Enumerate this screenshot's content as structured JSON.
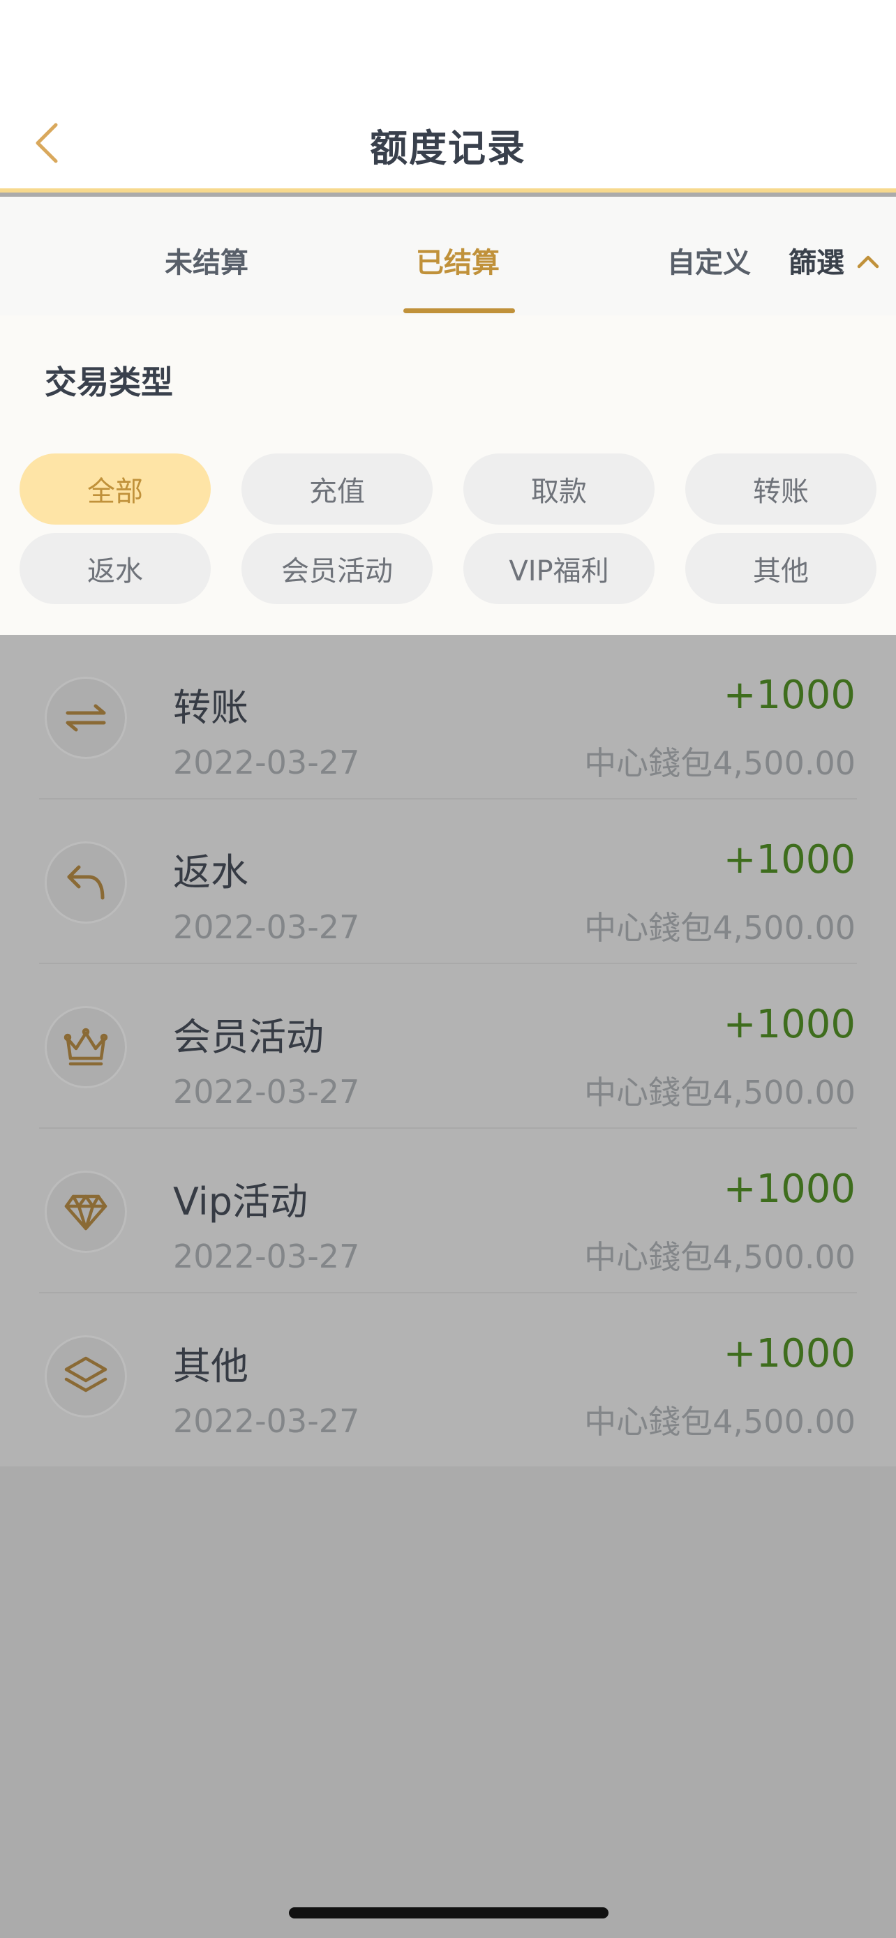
{
  "header": {
    "title": "额度记录"
  },
  "tabs": [
    {
      "label": "未结算"
    },
    {
      "label": "已结算"
    },
    {
      "label": "自定义"
    }
  ],
  "filter_toggle": {
    "label": "篩選"
  },
  "filter_panel": {
    "title": "交易类型",
    "chips": [
      {
        "label": "全部",
        "selected": true
      },
      {
        "label": "充值",
        "selected": false
      },
      {
        "label": "取款",
        "selected": false
      },
      {
        "label": "转账",
        "selected": false
      },
      {
        "label": "返水",
        "selected": false
      },
      {
        "label": "会员活动",
        "selected": false
      },
      {
        "label": "VIP福利",
        "selected": false
      },
      {
        "label": "其他",
        "selected": false
      }
    ]
  },
  "transactions": [
    {
      "icon": "transfer-icon",
      "name": "转账",
      "date": "2022-03-27",
      "amount": "+1000",
      "balance": "中心錢包4,500.00"
    },
    {
      "icon": "rebate-icon",
      "name": "返水",
      "date": "2022-03-27",
      "amount": "+1000",
      "balance": "中心錢包4,500.00"
    },
    {
      "icon": "crown-icon",
      "name": "会员活动",
      "date": "2022-03-27",
      "amount": "+1000",
      "balance": "中心錢包4,500.00"
    },
    {
      "icon": "diamond-icon",
      "name": "Vip活动",
      "date": "2022-03-27",
      "amount": "+1000",
      "balance": "中心錢包4,500.00"
    },
    {
      "icon": "layers-icon",
      "name": "其他",
      "date": "2022-03-27",
      "amount": "+1000",
      "balance": "中心錢包4,500.00"
    }
  ],
  "colors": {
    "accent": "#c0913a",
    "accent_light": "#fee4a6",
    "header_border": "#f7d98d",
    "positive_amount": "#3e6d1d",
    "overlay": "#ababab"
  }
}
